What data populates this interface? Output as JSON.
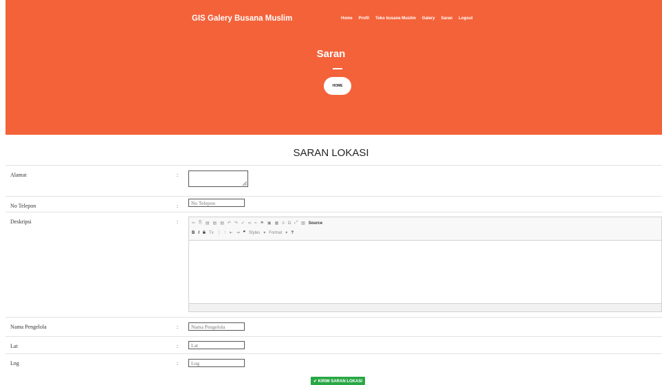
{
  "header": {
    "brand": "GIS Galery Busana Muslim",
    "nav": [
      "Home",
      "Profil",
      "Toko busana Muslim",
      "Galery",
      "Saran",
      "Logout"
    ],
    "page_title": "Saran",
    "home_button": "HOME"
  },
  "colors": {
    "hero": "#f4623a",
    "submit": "#28a745"
  },
  "form": {
    "title": "SARAN LOKASI",
    "colon": ":",
    "alamat_label": "Alamat",
    "telepon_label": "No Telepon",
    "telepon_placeholder": "No Telepon",
    "deskripsi_label": "Deskripsi",
    "pengelola_label": "Nama Pengelola",
    "pengelola_placeholder": "Nama Pengelola",
    "lat_label": "Lat",
    "lat_placeholder": "Lat",
    "lng_label": "Lng",
    "lng_placeholder": "Lng",
    "submit_label": "✔ KIRIM SARAN LOKASI"
  },
  "editor": {
    "source_label": "Source",
    "styles_label": "Styles",
    "format_label": "Format",
    "help_label": "?"
  }
}
